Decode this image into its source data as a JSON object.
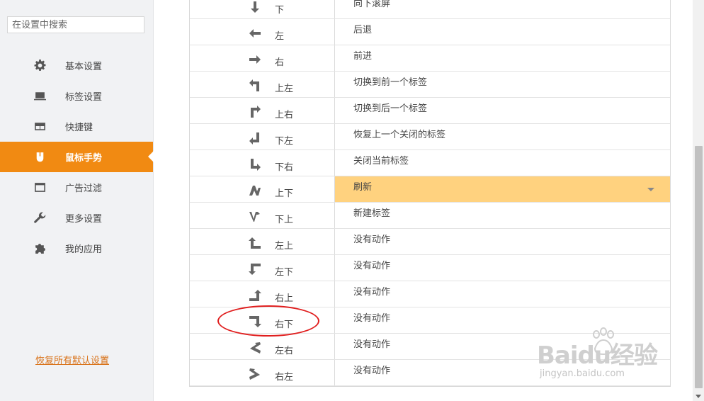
{
  "sidebar": {
    "search_placeholder": "在设置中搜索",
    "items": [
      {
        "label": "基本设置",
        "icon": "gear-icon"
      },
      {
        "label": "标签设置",
        "icon": "laptop-icon"
      },
      {
        "label": "快捷键",
        "icon": "keyboard-icon"
      },
      {
        "label": "鼠标手势",
        "icon": "mouse-icon",
        "active": true
      },
      {
        "label": "广告过滤",
        "icon": "window-icon"
      },
      {
        "label": "更多设置",
        "icon": "wrench-icon"
      },
      {
        "label": "我的应用",
        "icon": "puzzle-icon"
      }
    ],
    "reset_label": "恢复所有默认设置"
  },
  "gestures": [
    {
      "gesture": "下",
      "action": "向下滚屏",
      "icon": "arrow-down-icon"
    },
    {
      "gesture": "左",
      "action": "后退",
      "icon": "arrow-left-icon"
    },
    {
      "gesture": "右",
      "action": "前进",
      "icon": "arrow-right-icon"
    },
    {
      "gesture": "上左",
      "action": "切换到前一个标签",
      "icon": "arrow-up-left-icon"
    },
    {
      "gesture": "上右",
      "action": "切换到后一个标签",
      "icon": "arrow-up-right-icon"
    },
    {
      "gesture": "下左",
      "action": "恢复上一个关闭的标签",
      "icon": "arrow-down-left-icon"
    },
    {
      "gesture": "下右",
      "action": "关闭当前标签",
      "icon": "arrow-down-right-icon"
    },
    {
      "gesture": "上下",
      "action": "刷新",
      "icon": "arrow-up-down-icon",
      "selected": true
    },
    {
      "gesture": "下上",
      "action": "新建标签",
      "icon": "arrow-down-up-icon"
    },
    {
      "gesture": "左上",
      "action": "没有动作",
      "icon": "arrow-left-up-icon"
    },
    {
      "gesture": "左下",
      "action": "没有动作",
      "icon": "arrow-left-down-icon"
    },
    {
      "gesture": "右上",
      "action": "没有动作",
      "icon": "arrow-right-up-icon"
    },
    {
      "gesture": "右下",
      "action": "没有动作",
      "icon": "arrow-right-down-icon"
    },
    {
      "gesture": "左右",
      "action": "没有动作",
      "icon": "arrow-left-right-icon"
    },
    {
      "gesture": "右左",
      "action": "没有动作",
      "icon": "arrow-right-left-icon"
    }
  ],
  "watermark": {
    "brand": "Baidu经验",
    "url": "jingyan.baidu.com"
  },
  "colors": {
    "accent": "#f18a12",
    "selected_row": "#ffd27f",
    "annotation": "#e01f1f",
    "icon": "#666666"
  }
}
